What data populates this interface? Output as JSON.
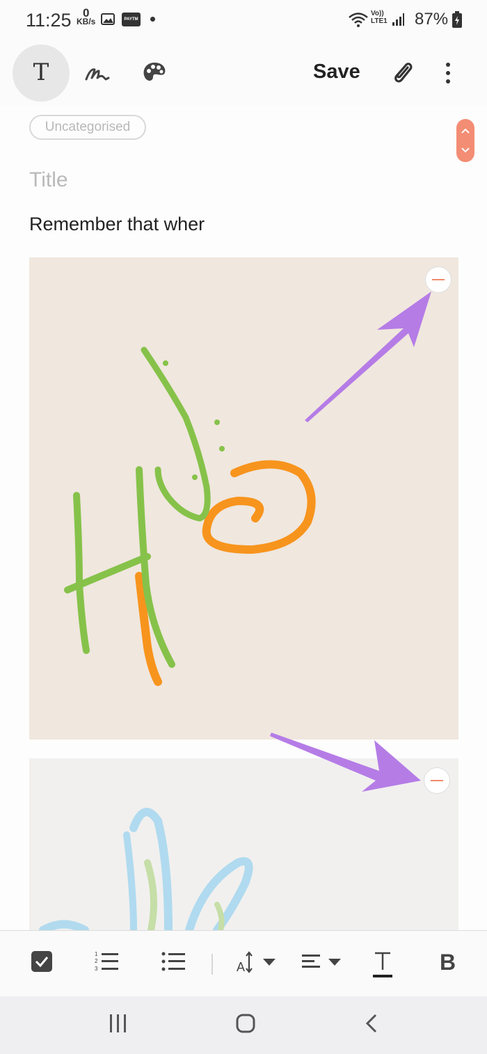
{
  "status_bar": {
    "time": "11:25",
    "net_speed_value": "0",
    "net_speed_unit": "KB/s",
    "paytm_label": "PAYTM",
    "volte_label_1": "Vo))",
    "volte_label_2": "LTE1",
    "battery": "87%"
  },
  "toolbar": {
    "save_label": "Save"
  },
  "note": {
    "category": "Uncategorised",
    "title_placeholder": "Title",
    "body": "Remember that wher"
  },
  "colors": {
    "accent": "#f08a6a",
    "arrow": "#b57ce6",
    "green_ink": "#86c24a",
    "orange_ink": "#f7941d",
    "blue_ink": "#9bd3ef"
  },
  "icons": {
    "text_mode": "text-icon",
    "handwriting": "pen-icon",
    "drawing": "palette-icon",
    "attach": "paperclip-icon",
    "more": "more-vert-icon",
    "checkbox": "checkbox-icon",
    "numbered_list": "numbered-list-icon",
    "bullet_list": "bullet-list-icon",
    "font_size": "font-size-icon",
    "align": "align-icon",
    "text_color": "text-color-icon",
    "bold": "bold-icon"
  }
}
